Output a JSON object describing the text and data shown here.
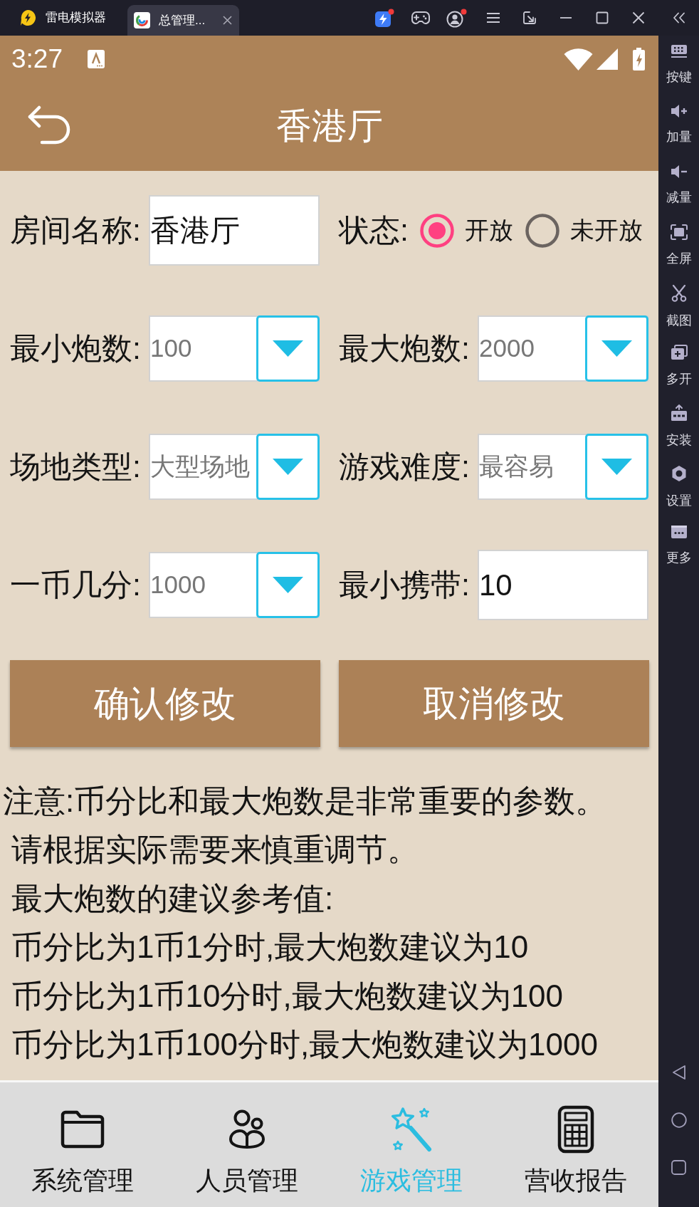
{
  "emulator": {
    "app_name": "雷电模拟器",
    "tabs": [
      {
        "label": "总管理...",
        "selected": true
      }
    ],
    "sidebar": [
      "按键",
      "加量",
      "减量",
      "全屏",
      "截图",
      "多开",
      "安装",
      "设置",
      "更多"
    ]
  },
  "status_bar": {
    "time": "3:27"
  },
  "header": {
    "title": "香港厅"
  },
  "form": {
    "fields": [
      {
        "kind": "text",
        "label": "房间名称:",
        "value": "香港厅"
      },
      {
        "kind": "radio",
        "label": "状态:",
        "options": [
          {
            "label": "开放",
            "selected": true
          },
          {
            "label": "未开放",
            "selected": false
          }
        ]
      },
      {
        "kind": "dropdown",
        "label": "最小炮数:",
        "value": "100"
      },
      {
        "kind": "dropdown",
        "label": "最大炮数:",
        "value": "2000"
      },
      {
        "kind": "dropdown",
        "label": "场地类型:",
        "value": "大型场地"
      },
      {
        "kind": "dropdown",
        "label": "游戏难度:",
        "value": "最容易"
      },
      {
        "kind": "dropdown",
        "label": "一币几分:",
        "value": "1000"
      },
      {
        "kind": "text",
        "label": "最小携带:",
        "value": "10"
      }
    ]
  },
  "buttons": [
    "确认修改",
    "取消修改"
  ],
  "notes": [
    "注意:币分比和最大炮数是非常重要的参数。",
    "请根据实际需要来慎重调节。",
    "最大炮数的建议参考值:",
    "币分比为1币1分时,最大炮数建议为10",
    "币分比为1币10分时,最大炮数建议为100",
    "币分比为1币100分时,最大炮数建议为1000"
  ],
  "bottom_nav": [
    {
      "label": "系统管理",
      "selected": false
    },
    {
      "label": "人员管理",
      "selected": false
    },
    {
      "label": "游戏管理",
      "selected": true
    },
    {
      "label": "营收报告",
      "selected": false
    }
  ]
}
